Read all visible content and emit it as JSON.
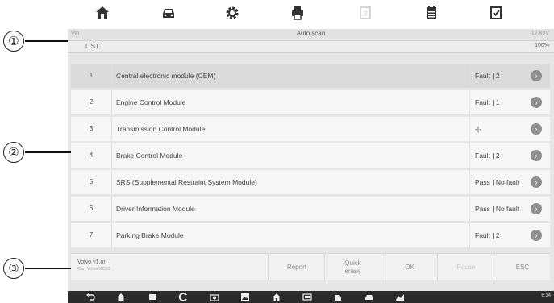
{
  "toolbar": {
    "icons": [
      "home-icon",
      "vehicle-icon",
      "gear-icon",
      "print-icon",
      "help-icon",
      "datalog-icon",
      "screenshot-icon"
    ]
  },
  "header": {
    "app_label": "Vin",
    "title": "Auto scan",
    "battery": "12.89V"
  },
  "list_bar": {
    "label": "LIST",
    "progress": "100%"
  },
  "modules": [
    {
      "num": "1",
      "name": "Central electronic module (CEM)",
      "status": "Fault | 2",
      "selected": true
    },
    {
      "num": "2",
      "name": "Engine Control Module",
      "status": "Fault | 1",
      "selected": false
    },
    {
      "num": "3",
      "name": "Transmission Control Module",
      "status": "-|-",
      "selected": false
    },
    {
      "num": "4",
      "name": "Brake Control Module",
      "status": "Fault | 2",
      "selected": false
    },
    {
      "num": "5",
      "name": "SRS (Supplemental Restraint System Module)",
      "status": "Pass | No fault",
      "selected": false
    },
    {
      "num": "6",
      "name": "Driver Information Module",
      "status": "Pass | No fault",
      "selected": false
    },
    {
      "num": "7",
      "name": "Parking Brake Module",
      "status": "Fault | 2",
      "selected": false
    }
  ],
  "footer": {
    "vehicle": "Volvo v1.m",
    "vehicle_sub": "Car: Volvo/XC60",
    "buttons": {
      "report": "Report",
      "quick_erase": "Quick erase",
      "ok": "OK",
      "pause": "Pause",
      "esc": "ESC"
    }
  },
  "system_nav": {
    "status": "6:34"
  },
  "callouts": {
    "one": "①",
    "two": "②",
    "three": "③"
  }
}
